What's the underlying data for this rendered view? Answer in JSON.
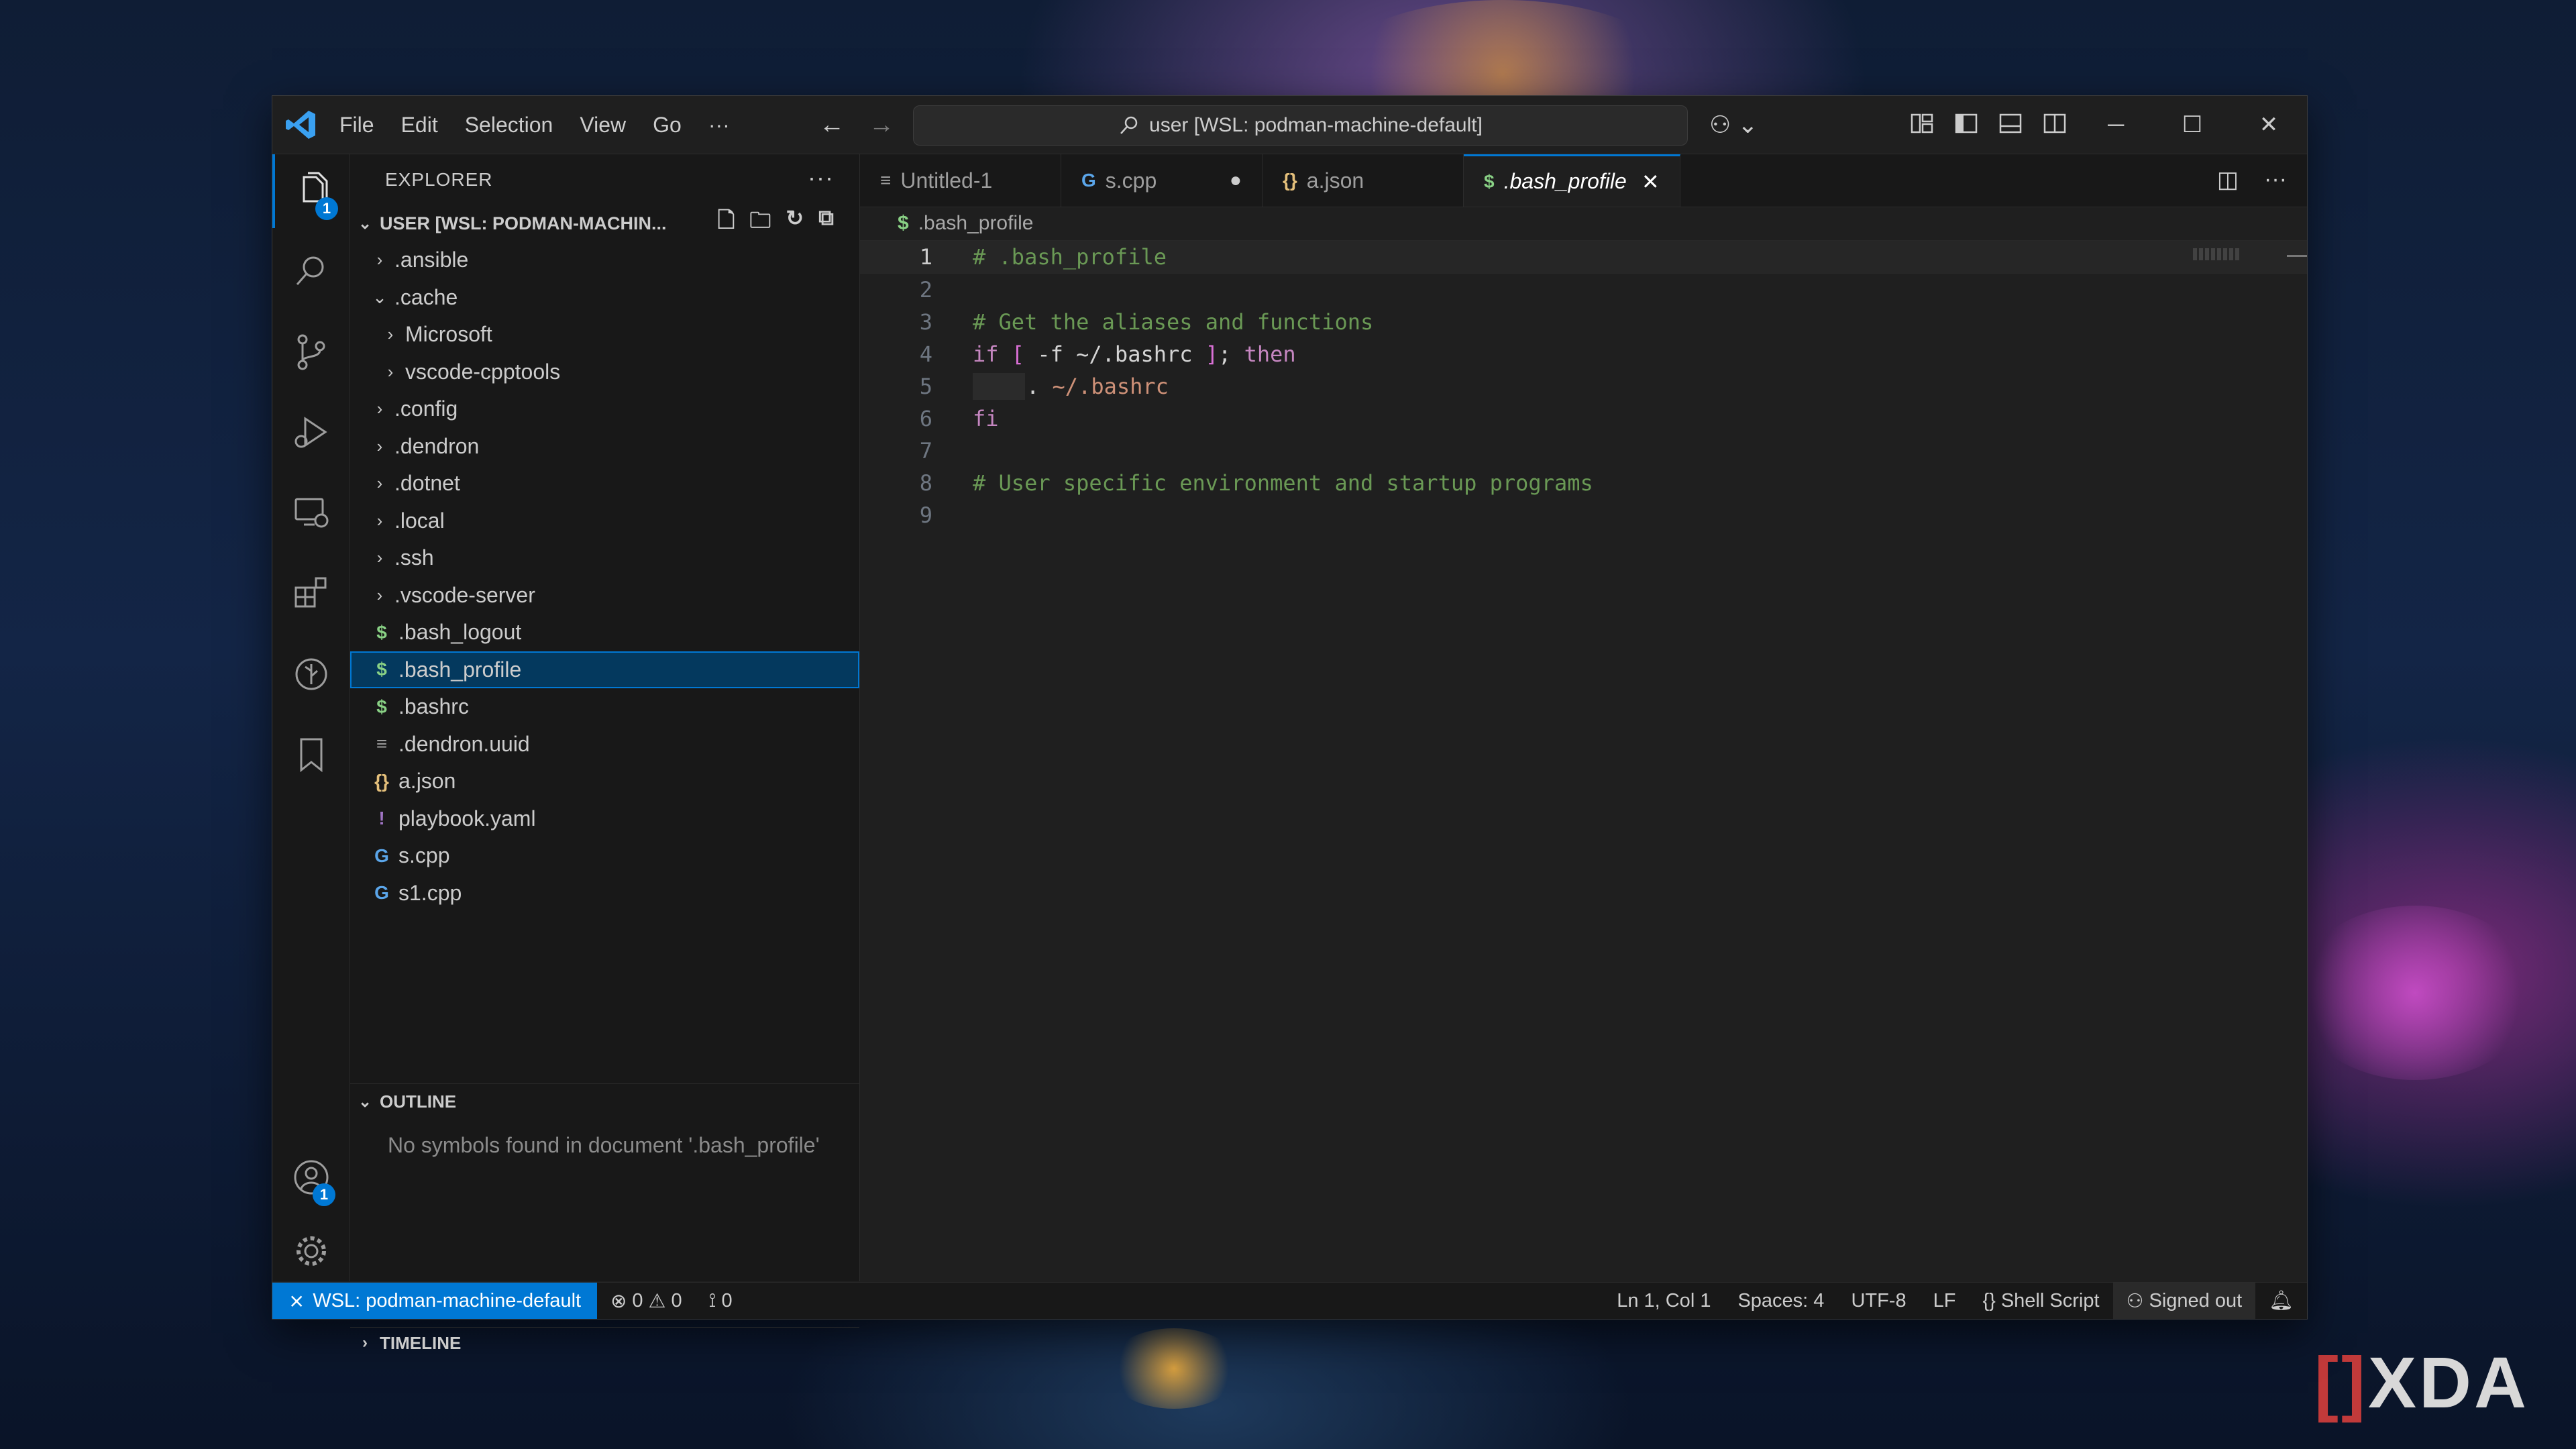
{
  "window": {
    "menu": [
      "File",
      "Edit",
      "Selection",
      "View",
      "Go",
      "···"
    ],
    "search_text": "user [WSL: podman-machine-default]"
  },
  "activity_bar": {
    "explorer_badge": "1",
    "accounts_badge": "1"
  },
  "explorer": {
    "title": "EXPLORER",
    "more": "···",
    "folder_name": "USER [WSL: PODMAN-MACHIN...",
    "items": [
      {
        "label": ".ansible",
        "type": "folder",
        "expanded": false,
        "depth": 0
      },
      {
        "label": ".cache",
        "type": "folder",
        "expanded": true,
        "depth": 0
      },
      {
        "label": "Microsoft",
        "type": "folder",
        "expanded": false,
        "depth": 1
      },
      {
        "label": "vscode-cpptools",
        "type": "folder",
        "expanded": false,
        "depth": 1
      },
      {
        "label": ".config",
        "type": "folder",
        "expanded": false,
        "depth": 0
      },
      {
        "label": ".dendron",
        "type": "folder",
        "expanded": false,
        "depth": 0
      },
      {
        "label": ".dotnet",
        "type": "folder",
        "expanded": false,
        "depth": 0
      },
      {
        "label": ".local",
        "type": "folder",
        "expanded": false,
        "depth": 0
      },
      {
        "label": ".ssh",
        "type": "folder",
        "expanded": false,
        "depth": 0
      },
      {
        "label": ".vscode-server",
        "type": "folder",
        "expanded": false,
        "depth": 0
      },
      {
        "label": ".bash_logout",
        "type": "shell",
        "icon": "$",
        "depth": 0
      },
      {
        "label": ".bash_profile",
        "type": "shell",
        "icon": "$",
        "depth": 0,
        "selected": true
      },
      {
        "label": ".bashrc",
        "type": "shell",
        "icon": "$",
        "depth": 0
      },
      {
        "label": ".dendron.uuid",
        "type": "text",
        "icon": "≡",
        "depth": 0
      },
      {
        "label": "a.json",
        "type": "json",
        "icon": "{}",
        "depth": 0
      },
      {
        "label": "playbook.yaml",
        "type": "yaml",
        "icon": "!",
        "depth": 0
      },
      {
        "label": "s.cpp",
        "type": "cpp",
        "icon": "G",
        "depth": 0
      },
      {
        "label": "s1.cpp",
        "type": "cpp",
        "icon": "G",
        "depth": 0
      }
    ],
    "outline_title": "OUTLINE",
    "outline_message": "No symbols found in document '.bash_profile'",
    "timeline_title": "TIMELINE"
  },
  "tabs": [
    {
      "label": "Untitled-1",
      "icon": "≡",
      "active": false,
      "modified": false
    },
    {
      "label": "s.cpp",
      "icon": "G",
      "active": false,
      "modified": true
    },
    {
      "label": "a.json",
      "icon": "{}",
      "active": false,
      "modified": false
    },
    {
      "label": ".bash_profile",
      "icon": "$",
      "active": true,
      "modified": false
    }
  ],
  "breadcrumb": {
    "icon": "$",
    "file": ".bash_profile"
  },
  "code_lines": [
    {
      "n": "1",
      "comment": "# .bash_profile"
    },
    {
      "n": "2"
    },
    {
      "n": "3",
      "comment": "# Get the aliases and functions"
    },
    {
      "n": "4",
      "kw1": "if",
      "br1": "[",
      "mid": " -f ~/.bashrc ",
      "br2": "]",
      "semi": "; ",
      "kw2": "then"
    },
    {
      "n": "5",
      "dot": ".",
      "str": " ~/.bashrc"
    },
    {
      "n": "6",
      "kw1": "fi"
    },
    {
      "n": "7"
    },
    {
      "n": "8",
      "comment": "# User specific environment and startup programs"
    },
    {
      "n": "9"
    }
  ],
  "statusbar": {
    "remote": "WSL: podman-machine-default",
    "errors": "0",
    "warnings": "0",
    "ports": "0",
    "position": "Ln 1, Col 1",
    "spaces": "Spaces: 4",
    "encoding": "UTF-8",
    "eol": "LF",
    "language": "Shell Script",
    "account": "Signed out"
  },
  "watermark": "XDA",
  "colors": {
    "accent": "#0078d4",
    "comment": "#6a9955",
    "keyword": "#c586c0",
    "string": "#ce9178",
    "shell_icon": "#89d185"
  }
}
